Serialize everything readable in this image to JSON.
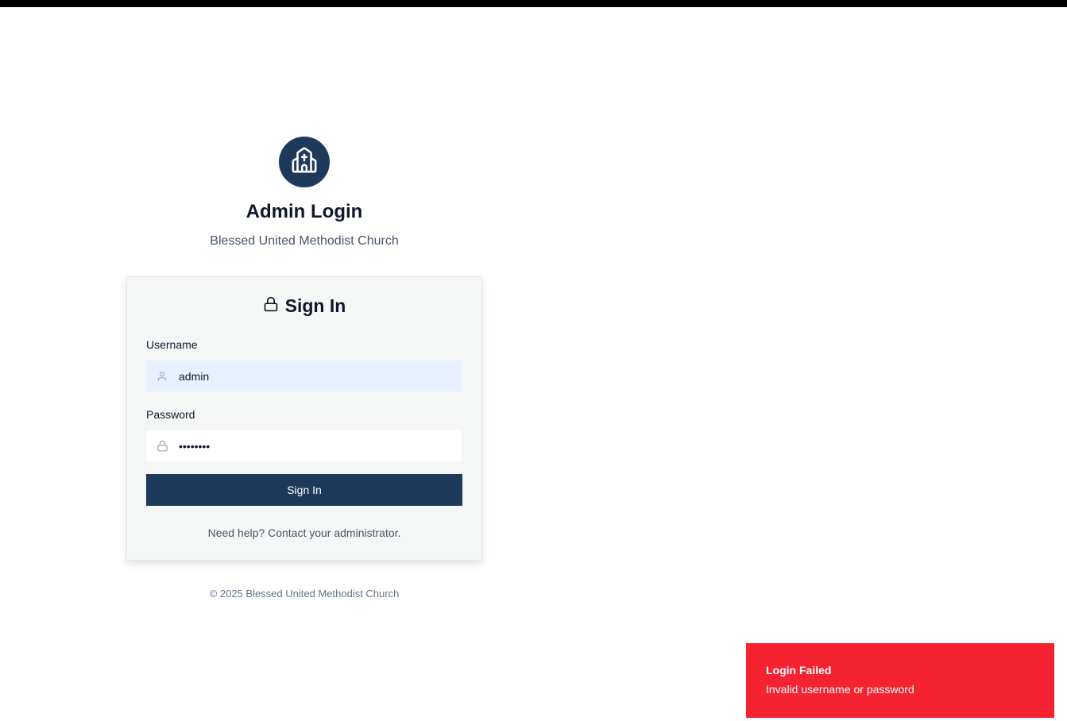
{
  "header": {
    "title": "Admin Login",
    "subtitle": "Blessed United Methodist Church",
    "logo_icon": "church-icon"
  },
  "card": {
    "title": "Sign In",
    "title_icon": "lock-icon",
    "username": {
      "label": "Username",
      "value": "admin",
      "icon": "user-icon"
    },
    "password": {
      "label": "Password",
      "value": "password",
      "icon": "lock-icon"
    },
    "submit_label": "Sign In",
    "help_text": "Need help? Contact your administrator."
  },
  "footer": {
    "copyright": "© 2025 Blessed United Methodist Church"
  },
  "toast": {
    "title": "Login Failed",
    "message": "Invalid username or password",
    "color": "#f52231"
  },
  "colors": {
    "brand": "#1e3a5a",
    "card_background": "#f5f7f6",
    "autofill_background": "#e8f0fe"
  }
}
